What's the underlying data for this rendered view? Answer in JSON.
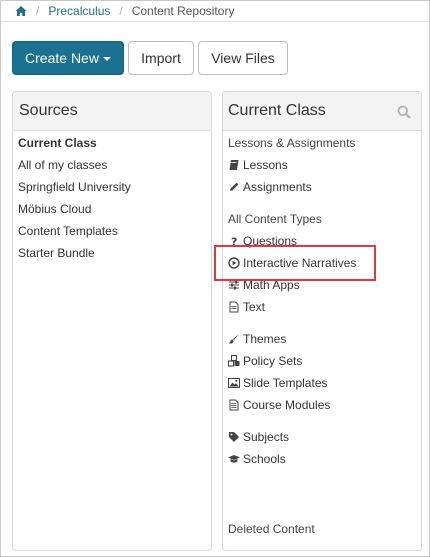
{
  "breadcrumb": {
    "home_icon": "home-icon",
    "items": [
      "Precalculus",
      "Content Repository"
    ]
  },
  "toolbar": {
    "create_label": "Create New",
    "import_label": "Import",
    "view_files_label": "View Files"
  },
  "sources": {
    "title": "Sources",
    "items": [
      "Current Class",
      "All of my classes",
      "Springfield University",
      "Möbius Cloud",
      "Content Templates",
      "Starter Bundle"
    ]
  },
  "current_class": {
    "title": "Current Class",
    "search_icon": "search-icon",
    "lessons_group": "Lessons & Assignments",
    "lessons": "Lessons",
    "assignments": "Assignments",
    "content_group": "All Content Types",
    "questions": "Questions",
    "interactive_narratives": "Interactive Narratives",
    "math_apps": "Math Apps",
    "text": "Text",
    "themes": "Themes",
    "policy_sets": "Policy Sets",
    "slide_templates": "Slide Templates",
    "course_modules": "Course Modules",
    "subjects": "Subjects",
    "schools": "Schools",
    "deleted_content": "Deleted Content"
  },
  "colors": {
    "primary": "#1a7290",
    "link": "#1f6f8b",
    "highlight": "#e0383e"
  }
}
